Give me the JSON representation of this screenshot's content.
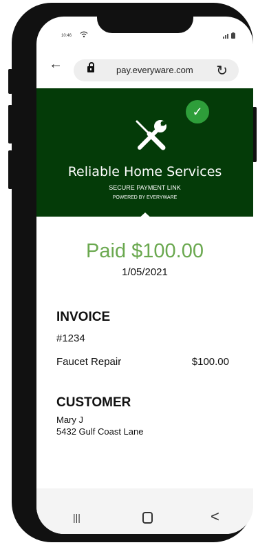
{
  "status_bar": {
    "time": "10:46",
    "wifi_icon": "wifi-icon",
    "signal_icon": "signal-icon",
    "battery_icon": "battery-icon"
  },
  "browser": {
    "url": "pay.everyware.com",
    "back_glyph": "←",
    "reload_glyph": "↻"
  },
  "header": {
    "check_glyph": "✓",
    "business_name": "Reliable Home Services",
    "subtitle": "SECURE PAYMENT LINK",
    "powered_by": "POWERED BY EVERYWARE",
    "background_color": "#043b08",
    "check_color": "#2e9e3a"
  },
  "payment": {
    "status": "Paid $100.00",
    "date": "1/05/2021",
    "status_color": "#6aa84f"
  },
  "invoice": {
    "title": "INVOICE",
    "number": "#1234",
    "items": [
      {
        "name": "Faucet Repair",
        "amount": "$100.00"
      }
    ]
  },
  "customer": {
    "title": "CUSTOMER",
    "name": "Mary J",
    "address": "5432 Gulf Coast Lane"
  },
  "nav": {
    "recent_glyph": "|||",
    "back_glyph": "<"
  }
}
